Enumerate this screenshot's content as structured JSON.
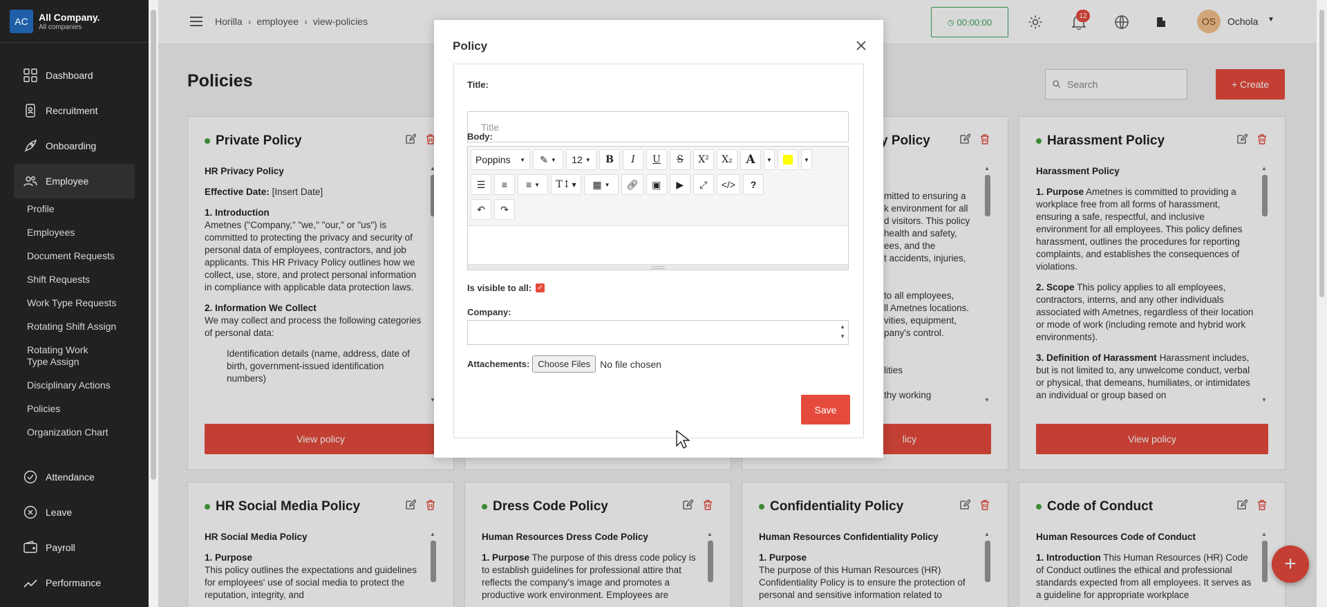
{
  "brand": {
    "logo": "AC",
    "name": "All Company.",
    "sub": "All companies"
  },
  "sidebar": {
    "items_top": [
      {
        "label": "Dashboard",
        "icon": "dashboard-icon"
      },
      {
        "label": "Recruitment",
        "icon": "recruitment-icon"
      },
      {
        "label": "Onboarding",
        "icon": "rocket-icon"
      },
      {
        "label": "Employee",
        "icon": "people-icon"
      }
    ],
    "sub_items": [
      "Profile",
      "Employees",
      "Document Requests",
      "Shift Requests",
      "Work Type Requests",
      "Rotating Shift Assign",
      "Rotating Work Type Assign",
      "Disciplinary Actions",
      "Policies",
      "Organization Chart"
    ],
    "items_bottom": [
      {
        "label": "Attendance",
        "icon": "check-circle-icon"
      },
      {
        "label": "Leave",
        "icon": "x-circle-icon"
      },
      {
        "label": "Payroll",
        "icon": "wallet-icon"
      },
      {
        "label": "Performance",
        "icon": "trend-icon"
      }
    ]
  },
  "header": {
    "breadcrumb": [
      "Horilla",
      "employee",
      "view-policies"
    ],
    "timer": "00:00:00",
    "notifications": "12",
    "user_initials": "OS",
    "user_name": "Ochola"
  },
  "page": {
    "title": "Policies",
    "search_placeholder": "Search",
    "create_label": "+ Create",
    "view_policy_label": "View policy"
  },
  "cards": {
    "private": {
      "title": "Private Policy",
      "subtitle": "HR Privacy Policy",
      "effective_label": "Effective Date:",
      "effective_value": "[Insert Date]",
      "s1_head": "1. Introduction",
      "s1_text": "Ametnes (\"Company,\" \"we,\" \"our,\" or \"us\") is committed to protecting the privacy and security of personal data of employees, contractors, and job applicants. This HR Privacy Policy outlines how we collect, use, store, and protect personal information in compliance with applicable data protection laws.",
      "s2_head": "2. Information We Collect",
      "s2_text": "We may collect and process the following categories of personal data:",
      "s2_item": "Identification details (name, address, date of birth, government-issued identification numbers)"
    },
    "hidden_partial": {
      "title_tail": "y Policy",
      "lines": [
        "mitted to ensuring a",
        "k environment for all",
        "d visitors. This policy",
        "health and safety,",
        "ees, and the",
        "t accidents, injuries,",
        "",
        "",
        "to all employees,",
        "ll Ametnes locations.",
        "vities, equipment,",
        "pany's control.",
        "",
        "",
        "lities",
        "",
        "thy working"
      ],
      "view_tail": "licy"
    },
    "harassment": {
      "title": "Harassment Policy",
      "subtitle": "Harassment Policy",
      "p1_head": "1. Purpose",
      "p1_text": "Ametnes is committed to providing a workplace free from all forms of harassment, ensuring a safe, respectful, and inclusive environment for all employees. This policy defines harassment, outlines the procedures for reporting complaints, and establishes the consequences of violations.",
      "p2_head": "2. Scope",
      "p2_text": "This policy applies to all employees, contractors, interns, and any other individuals associated with Ametnes, regardless of their location or mode of work (including remote and hybrid work environments).",
      "p3_head": "3. Definition of Harassment",
      "p3_text": "Harassment includes, but is not limited to, any unwelcome conduct, verbal or physical, that demeans, humiliates, or intimidates an individual or group based on"
    },
    "social": {
      "title": "HR Social Media Policy",
      "subtitle": "HR Social Media Policy",
      "p1_head": "1. Purpose",
      "p1_text": "This policy outlines the expectations and guidelines for employees' use of social media to protect the reputation, integrity, and"
    },
    "dress": {
      "title": "Dress Code Policy",
      "subtitle": "Human Resources Dress Code Policy",
      "p1_head": "1. Purpose",
      "p1_text": "The purpose of this dress code policy is to establish guidelines for professional attire that reflects the company's image and promotes a productive work environment. Employees are"
    },
    "confidentiality": {
      "title": "Confidentiality Policy",
      "subtitle": "Human Resources Confidentiality Policy",
      "p1_head": "1. Purpose",
      "p1_text": "The purpose of this Human Resources (HR) Confidentiality Policy is to ensure the protection of personal and sensitive information related to"
    },
    "conduct": {
      "title": "Code of Conduct",
      "subtitle": "Human Resources Code of Conduct",
      "p1_head": "1. Introduction",
      "p1_text": "This Human Resources (HR) Code of Conduct outlines the ethical and professional standards expected from all employees. It serves as a guideline for appropriate workplace"
    }
  },
  "modal": {
    "title": "Policy",
    "title_label": "Title:",
    "title_placeholder": "Title",
    "body_label": "Body:",
    "font_name": "Poppins",
    "font_size": "12",
    "visible_label": "Is visible to all:",
    "visible_checked": true,
    "company_label": "Company:",
    "attach_label": "Attachements:",
    "choose_files": "Choose Files",
    "no_file": "No file chosen",
    "save_label": "Save"
  },
  "colors": {
    "accent": "#e54b3c",
    "sidebar_bg": "#212121",
    "status_dot": "#47a23f",
    "timer_green": "#3aa35b"
  }
}
